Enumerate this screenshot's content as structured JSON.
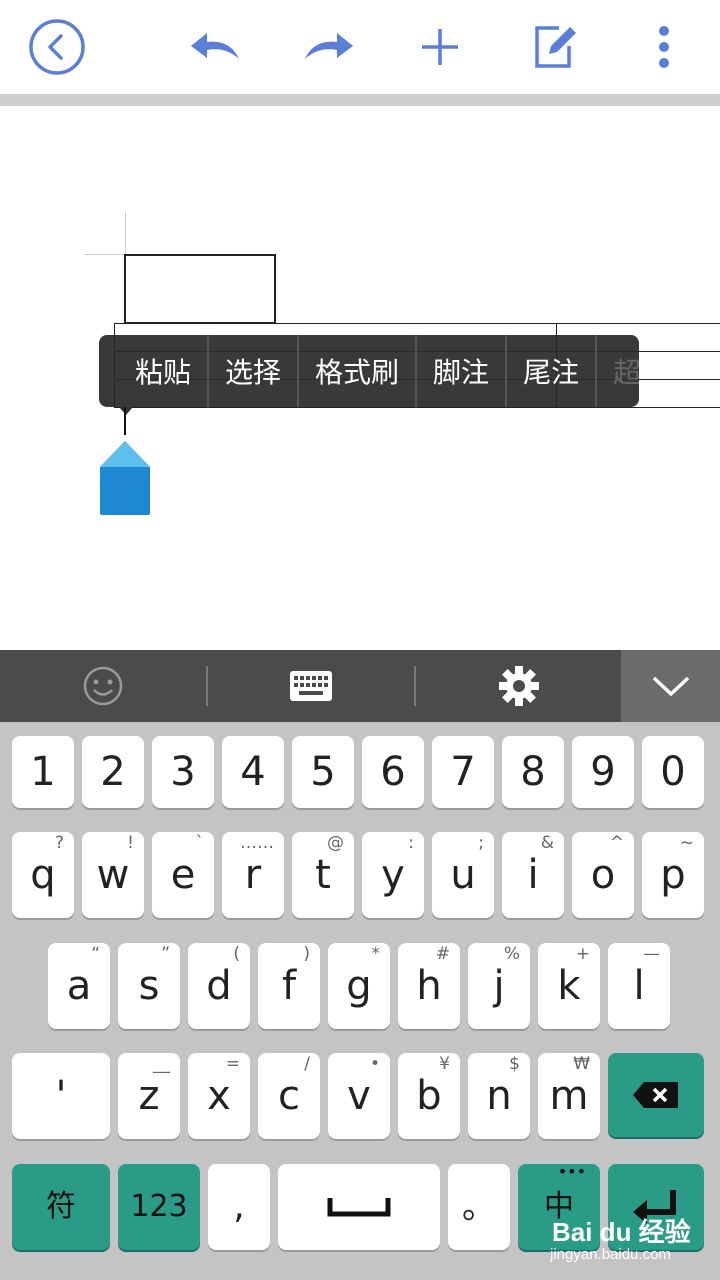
{
  "toolbar": {
    "back": "back-icon",
    "undo": "undo-icon",
    "redo": "redo-icon",
    "add": "plus-icon",
    "edit": "edit-icon",
    "more": "more-vertical-icon",
    "accent": "#5b7fd6"
  },
  "context_menu": {
    "items": [
      "粘贴",
      "选择",
      "格式刷",
      "脚注",
      "尾注",
      "超"
    ]
  },
  "keyboard_strip": {
    "emoji": "smiley-icon",
    "keyboard": "keyboard-icon",
    "settings": "gear-icon",
    "collapse": "chevron-down-icon"
  },
  "keyboard": {
    "row_numbers": [
      "1",
      "2",
      "3",
      "4",
      "5",
      "6",
      "7",
      "8",
      "9",
      "0"
    ],
    "row_q": [
      {
        "k": "q",
        "s": "?"
      },
      {
        "k": "w",
        "s": "!"
      },
      {
        "k": "e",
        "s": "`"
      },
      {
        "k": "r",
        "s": "……"
      },
      {
        "k": "t",
        "s": "@"
      },
      {
        "k": "y",
        "s": ":"
      },
      {
        "k": "u",
        "s": ";"
      },
      {
        "k": "i",
        "s": "&"
      },
      {
        "k": "o",
        "s": "^"
      },
      {
        "k": "p",
        "s": "~"
      }
    ],
    "row_a": [
      {
        "k": "a",
        "s": "“"
      },
      {
        "k": "s",
        "s": "”"
      },
      {
        "k": "d",
        "s": "("
      },
      {
        "k": "f",
        "s": ")"
      },
      {
        "k": "g",
        "s": "*"
      },
      {
        "k": "h",
        "s": "#"
      },
      {
        "k": "j",
        "s": "%"
      },
      {
        "k": "k",
        "s": "+"
      },
      {
        "k": "l",
        "s": "—"
      }
    ],
    "row_z": [
      {
        "k": "'",
        "s": ""
      },
      {
        "k": "z",
        "s": "__"
      },
      {
        "k": "x",
        "s": "="
      },
      {
        "k": "c",
        "s": "/"
      },
      {
        "k": "v",
        "s": "•"
      },
      {
        "k": "b",
        "s": "¥"
      },
      {
        "k": "n",
        "s": "$"
      },
      {
        "k": "m",
        "s": "₩"
      }
    ],
    "symbols_key": "符",
    "numbers_key": "123",
    "comma_key": ",",
    "period_key": "。",
    "lang_key": "中",
    "lang_dots": "•••",
    "backspace": "backspace-icon",
    "space": "space-icon",
    "enter": "enter-icon",
    "green": "#2a9b86"
  },
  "watermark": {
    "logo": "Bai du 经验",
    "url": "jingyan.baidu.com"
  }
}
